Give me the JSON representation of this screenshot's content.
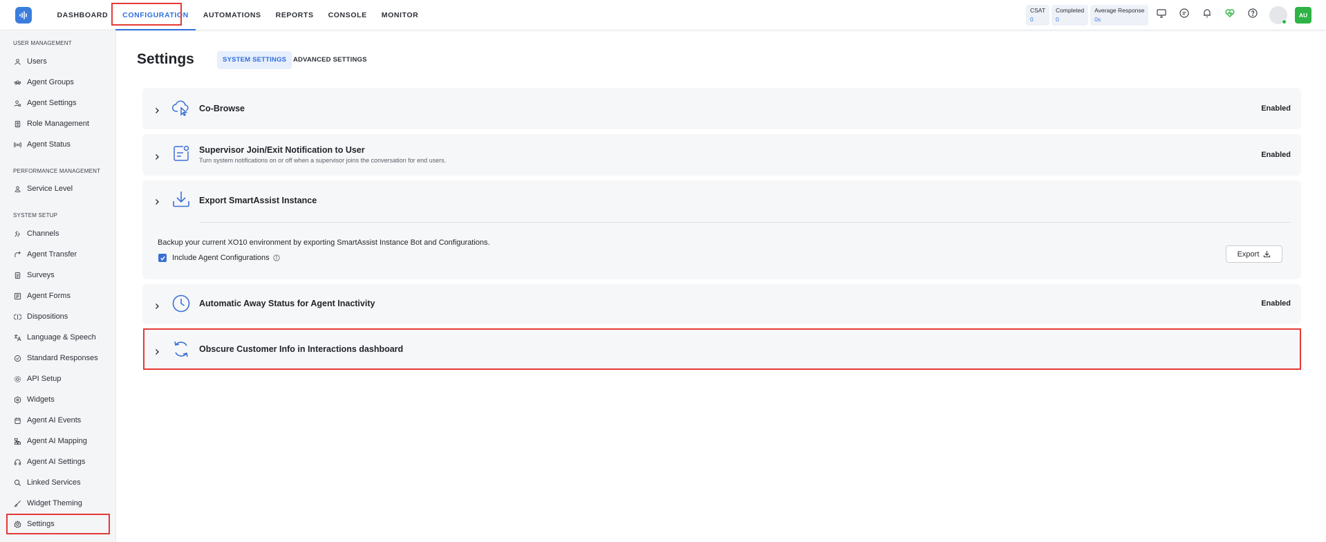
{
  "nav": {
    "items": [
      {
        "label": "DASHBOARD",
        "active": false
      },
      {
        "label": "CONFIGURATION",
        "active": true
      },
      {
        "label": "AUTOMATIONS",
        "active": false
      },
      {
        "label": "REPORTS",
        "active": false
      },
      {
        "label": "CONSOLE",
        "active": false
      },
      {
        "label": "MONITOR",
        "active": false
      }
    ]
  },
  "metrics": [
    {
      "label": "CSAT",
      "value": "0"
    },
    {
      "label": "Completed",
      "value": "0"
    },
    {
      "label": "Average Response",
      "value": "0s"
    }
  ],
  "user": {
    "initials": "AU",
    "status_color": "#2fb344"
  },
  "top_icons": [
    "monitor-icon",
    "chat-icon",
    "bell-icon",
    "heart-health-icon",
    "help-icon"
  ],
  "sidebar": {
    "sections": [
      {
        "title": "USER MANAGEMENT",
        "items": [
          {
            "label": "Users",
            "icon": "users-icon"
          },
          {
            "label": "Agent Groups",
            "icon": "agent-groups-icon"
          },
          {
            "label": "Agent Settings",
            "icon": "agent-settings-icon"
          },
          {
            "label": "Role Management",
            "icon": "role-icon"
          },
          {
            "label": "Agent Status",
            "icon": "status-icon"
          }
        ]
      },
      {
        "title": "PERFORMANCE MANAGEMENT",
        "items": [
          {
            "label": "Service Level",
            "icon": "service-level-icon"
          }
        ]
      },
      {
        "title": "SYSTEM SETUP",
        "items": [
          {
            "label": "Channels",
            "icon": "channels-icon"
          },
          {
            "label": "Agent Transfer",
            "icon": "transfer-icon"
          },
          {
            "label": "Surveys",
            "icon": "surveys-icon"
          },
          {
            "label": "Agent Forms",
            "icon": "forms-icon"
          },
          {
            "label": "Dispositions",
            "icon": "dispositions-icon"
          },
          {
            "label": "Language & Speech",
            "icon": "language-icon"
          },
          {
            "label": "Standard Responses",
            "icon": "responses-icon"
          },
          {
            "label": "API Setup",
            "icon": "api-icon"
          },
          {
            "label": "Widgets",
            "icon": "widgets-icon"
          },
          {
            "label": "Agent AI Events",
            "icon": "ai-events-icon"
          },
          {
            "label": "Agent AI Mapping",
            "icon": "ai-mapping-icon"
          },
          {
            "label": "Agent AI Settings",
            "icon": "headset-icon"
          },
          {
            "label": "Linked Services",
            "icon": "search-icon"
          },
          {
            "label": "Widget Theming",
            "icon": "brush-icon"
          },
          {
            "label": "Settings",
            "icon": "gear-icon",
            "active": true
          }
        ]
      }
    ]
  },
  "page": {
    "title": "Settings",
    "tabs": [
      {
        "label": "SYSTEM SETTINGS",
        "active": true
      },
      {
        "label": "ADVANCED SETTINGS",
        "active": false
      }
    ]
  },
  "settings": {
    "cobrowse": {
      "title": "Co-Browse",
      "status": "Enabled",
      "icon": "cloud-cursor-icon"
    },
    "supervisor": {
      "title": "Supervisor Join/Exit Notification to User",
      "subtitle": "Turn system notifications on or off when a supervisor joins the conversation for end users.",
      "status": "Enabled",
      "icon": "notification-icon"
    },
    "export": {
      "title": "Export SmartAssist Instance",
      "description": "Backup your current XO10 environment by exporting SmartAssist Instance Bot and Configurations.",
      "checkbox_label": "Include Agent Configurations",
      "checkbox_checked": true,
      "button_label": "Export",
      "icon": "download-icon"
    },
    "away": {
      "title": "Automatic Away Status for Agent Inactivity",
      "status": "Enabled",
      "icon": "clock-icon"
    },
    "obscure": {
      "title": "Obscure Customer Info in Interactions dashboard",
      "icon": "refresh-icon"
    }
  },
  "colors": {
    "accent": "#2f6fe0",
    "highlight": "#e53935",
    "enabled_green": "#2fb344"
  }
}
